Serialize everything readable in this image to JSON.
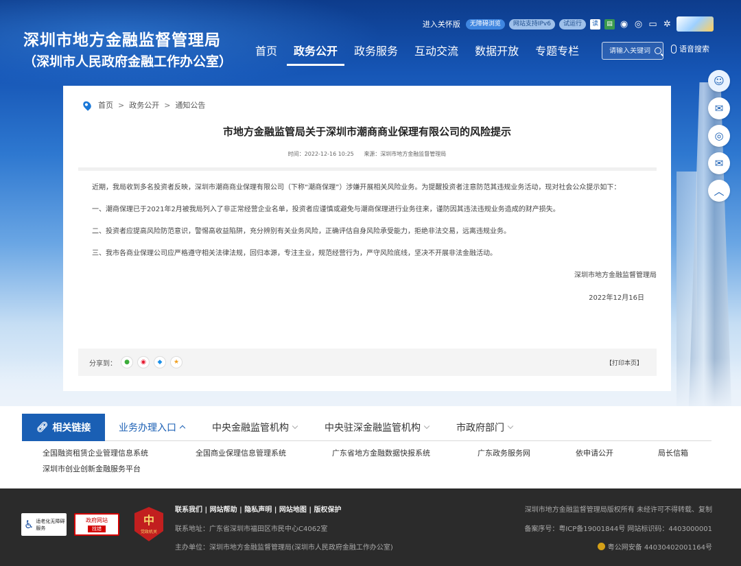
{
  "header": {
    "title": "深圳市地方金融监督管理局",
    "subtitle": "（深圳市人民政府金融工作办公室）",
    "util": {
      "care": "进入关怀版",
      "barrier_free": "无障碍浏览",
      "ipv6": "网站支持IPv6",
      "trial": "试运行"
    },
    "nav": [
      "首页",
      "政务公开",
      "政务服务",
      "互动交流",
      "数据开放",
      "专题专栏"
    ],
    "nav_active": "政务公开",
    "search_placeholder": "请输入关键词",
    "voice_search": "语音搜索"
  },
  "breadcrumb": [
    "首页",
    "政务公开",
    "通知公告"
  ],
  "article": {
    "title": "市地方金融监管局关于深圳市潮商商业保理有限公司的风险提示",
    "time_label": "时间：2022-12-16 10:25",
    "source_label": "来源：深圳市地方金融监督管理局",
    "paragraphs": [
      "近期，我局收到多名投资者反映，深圳市潮商商业保理有限公司（下称“潮商保理”）涉嫌开展相关风险业务。为提醒投资者注意防范其违规业务活动，现对社会公众提示如下：",
      "一、潮商保理已于2021年2月被我局列入了非正常经营企业名单，投资者应谨慎或避免与潮商保理进行业务往来，谨防因其违法违规业务造成的财产损失。",
      "二、投资者应提高风险防范意识，警惕高收益陷阱，充分辨别有关业务风险，正确评估自身风险承受能力，拒绝非法交易，远离违规业务。",
      "三、我市各商业保理公司应严格遵守相关法律法规，回归本源，专注主业，规范经营行为，严守风险底线，坚决不开展非法金融活动。"
    ],
    "signature": "深圳市地方金融监督管理局",
    "date": "2022年12月16日",
    "share_label": "分享到：",
    "print_label": "【打印本页】"
  },
  "related": {
    "main_tab": "相关链接",
    "tabs": [
      "业务办理入口",
      "中央金融监管机构",
      "中央驻深金融监管机构",
      "市政府部门"
    ],
    "links": [
      "全国融资租赁企业管理信息系统",
      "全国商业保理信息管理系统",
      "广东省地方金融数据快报系统",
      "广东政务服务网",
      "依申请公开",
      "局长信箱",
      "深圳市创业创新金融服务平台"
    ]
  },
  "footer": {
    "links": [
      "联系我们",
      "网站帮助",
      "隐私声明",
      "网站地图",
      "版权保护"
    ],
    "sep": " | ",
    "address": "联系地址：广东省深圳市福田区市民中心C4062室",
    "host": "主办单位：深圳市地方金融监督管理局(深圳市人民政府金融工作办公室)",
    "copyright": "深圳市地方金融监督管理局版权所有 未经许可不得转载、复制",
    "icp": "备案序号：粤ICP备19001844号 网站标识码：4403000001",
    "police": "粤公网安备 44030402001164号",
    "badge_elderly": "适老化无障碍服务",
    "badge_error_top": "政府网站",
    "badge_error_bottom": "找错",
    "badge_party_big": "中",
    "badge_party_small": "党政机关"
  },
  "colors": {
    "primary": "#1a5fb4",
    "footer_bg": "#2b2b2b"
  }
}
